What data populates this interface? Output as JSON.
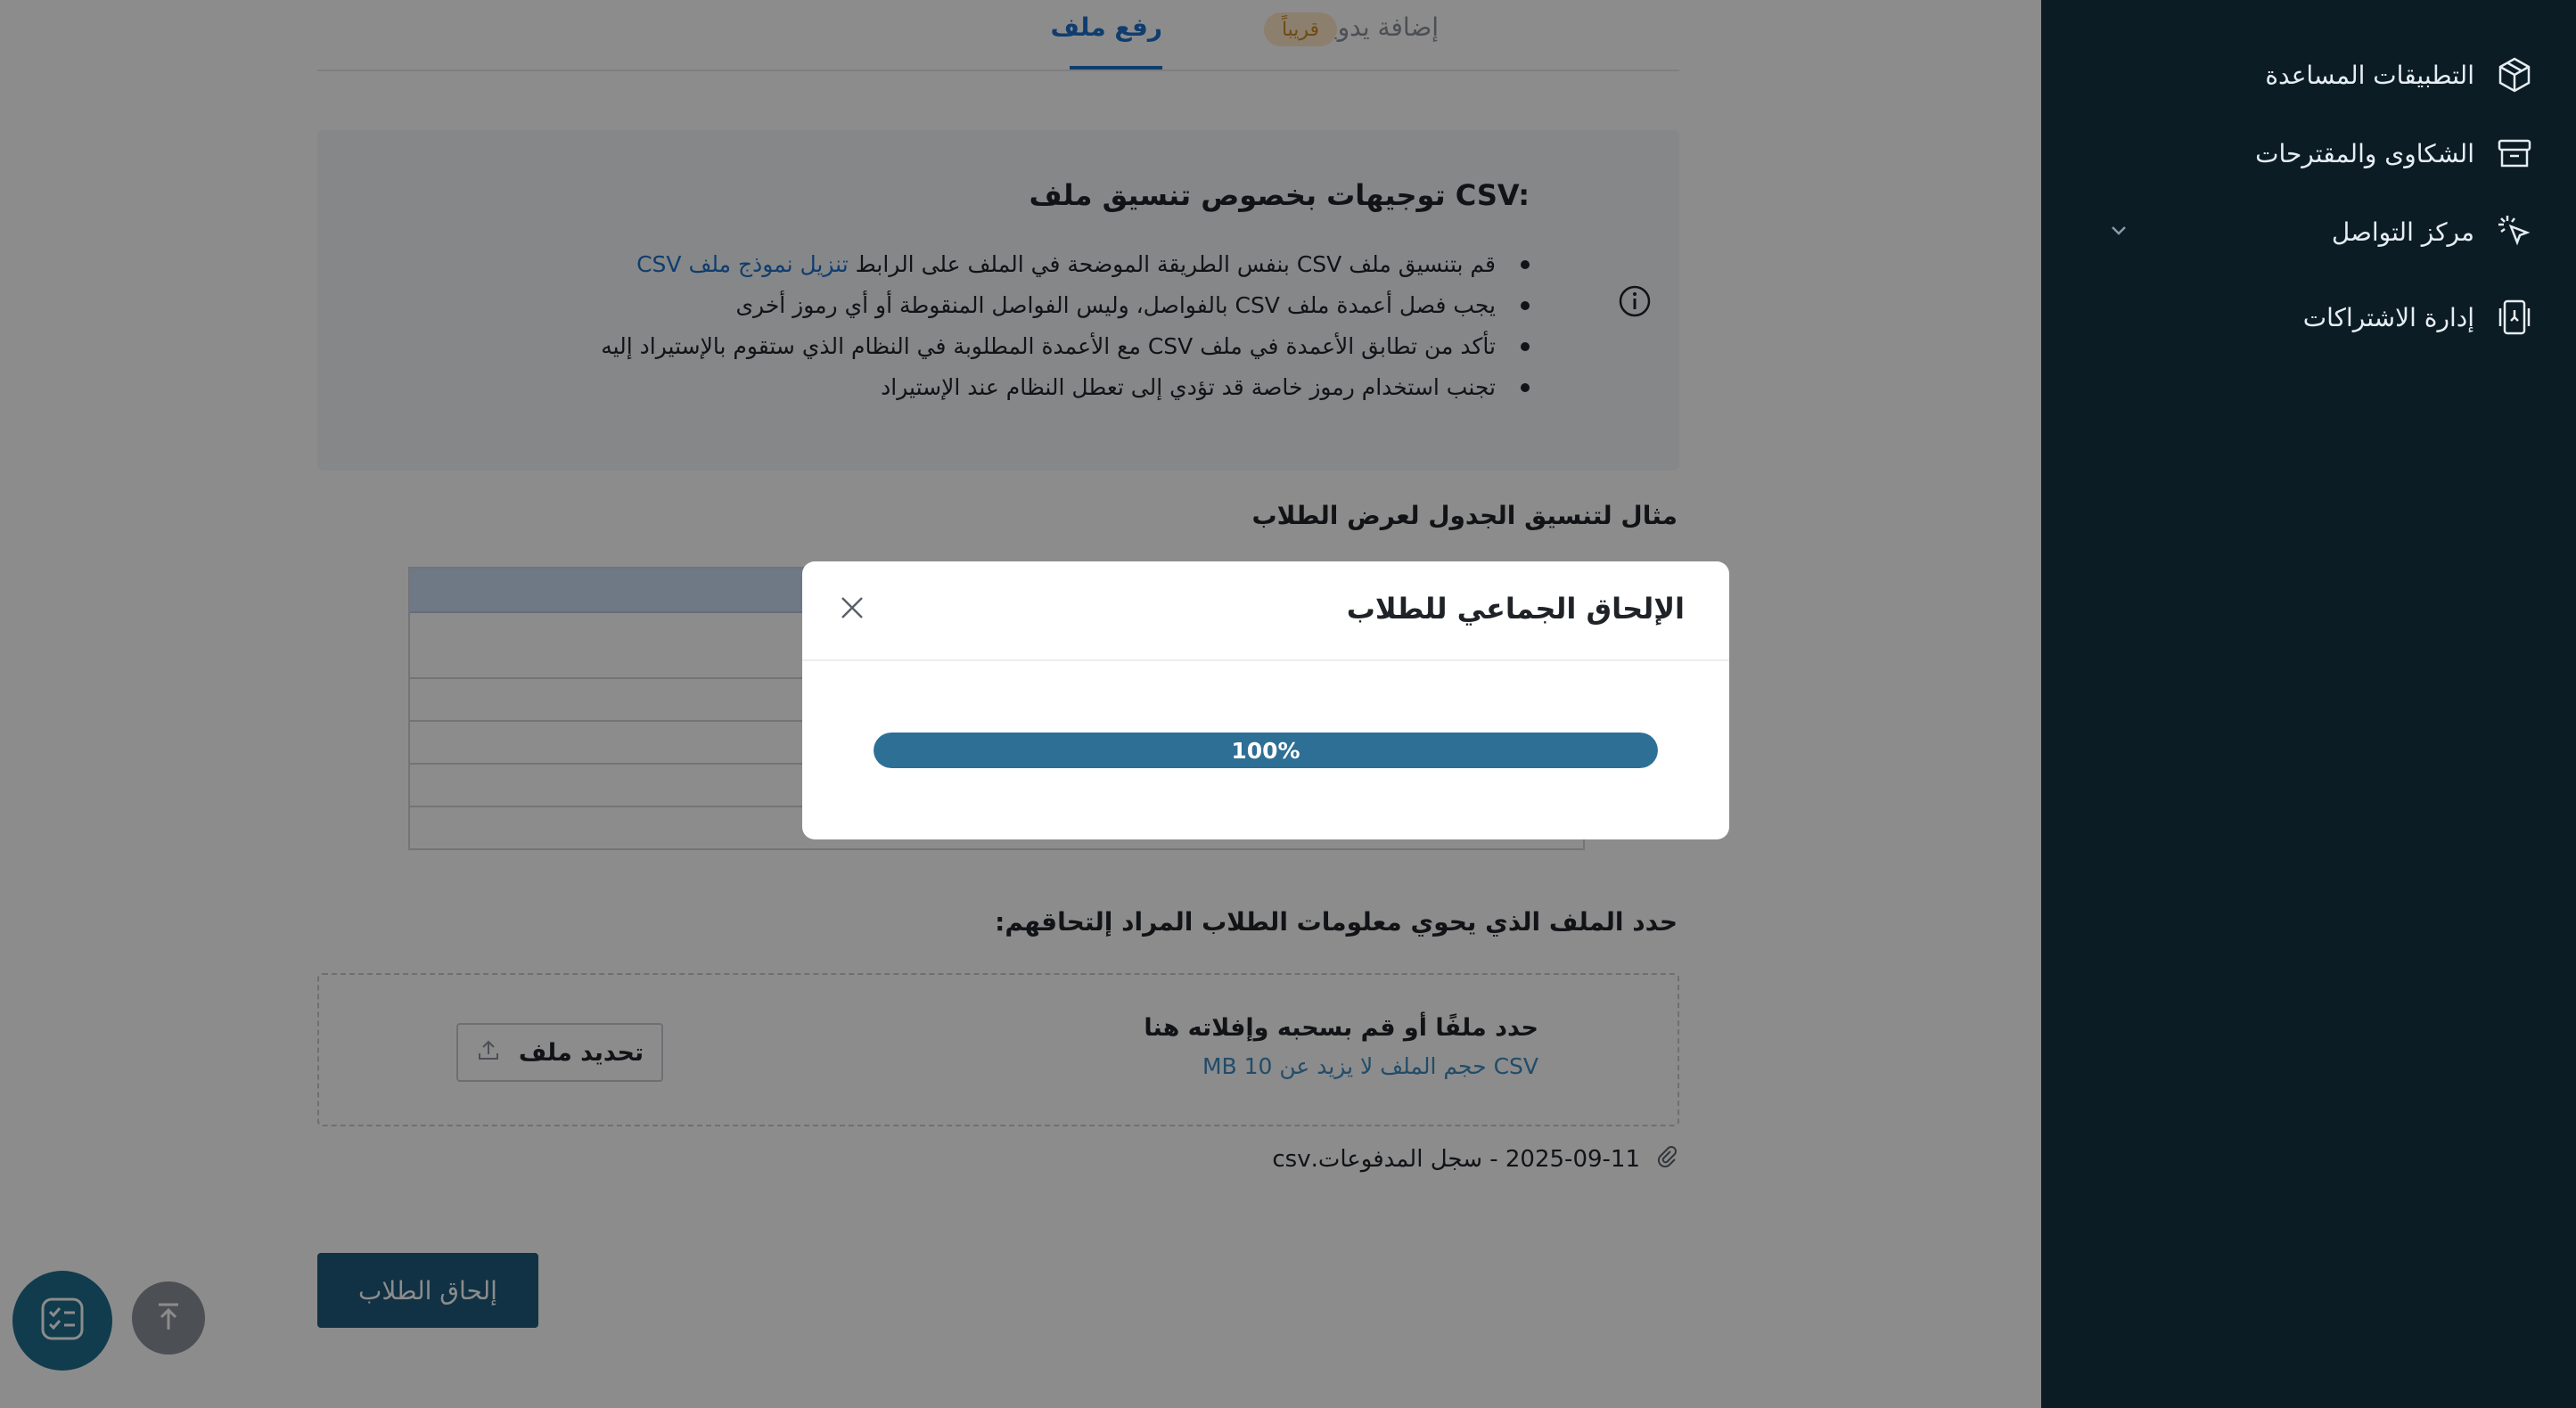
{
  "tabs": {
    "upload_label": "رفع ملف",
    "manual_label": "إضافة يدوية",
    "soon_badge": "قريباً"
  },
  "guidelines": {
    "title": "توجيهات بخصوص تنسيق ملف CSV:",
    "item1_text": "قم بتنسيق ملف CSV بنفس الطريقة الموضحة في الملف على الرابط ",
    "item1_link": "تنزيل نموذج ملف CSV",
    "item2": "يجب فصل أعمدة ملف CSV بالفواصل، وليس الفواصل المنقوطة أو أي رموز أخرى",
    "item3": "تأكد من تطابق الأعمدة في ملف CSV مع الأعمدة المطلوبة في النظام الذي ستقوم بالإستيراد إليه",
    "item4": "تجنب استخدام رموز خاصة قد تؤدي إلى تعطل النظام عند الإستيراد"
  },
  "example_title": "مثال لتنسيق الجدول لعرض الطلاب",
  "file_section": {
    "label": "حدد الملف الذي يحوي معلومات الطلاب المراد إلتحاقهم:",
    "dropzone_title": "حدد ملفًا أو قم بسحبه وإفلاته هنا",
    "dropzone_sub": "CSV حجم الملف لا يزيد عن 10 MB",
    "select_button": "تحديد ملف",
    "attached_file": "2025-09-11 - سجل المدفوعات.csv"
  },
  "enroll_button": "إلحاق الطلاب",
  "sidebar": {
    "items": [
      {
        "label": "التطبيقات المساعدة",
        "icon": "package-icon"
      },
      {
        "label": "الشكاوى والمقترحات",
        "icon": "archive-icon"
      },
      {
        "label": "مركز التواصل",
        "icon": "pointer-click-icon"
      },
      {
        "label": "إدارة الاشتراكات",
        "icon": "subscription-icon"
      }
    ]
  },
  "modal": {
    "title": "الإلحاق الجماعي للطلاب",
    "progress_value": 100,
    "progress_label": "100%"
  },
  "colors": {
    "accent": "#1e6fc8",
    "primary_button": "#1f5b7c",
    "progress": "#2e6f96",
    "sidebar_bg": "#0b1c25"
  }
}
